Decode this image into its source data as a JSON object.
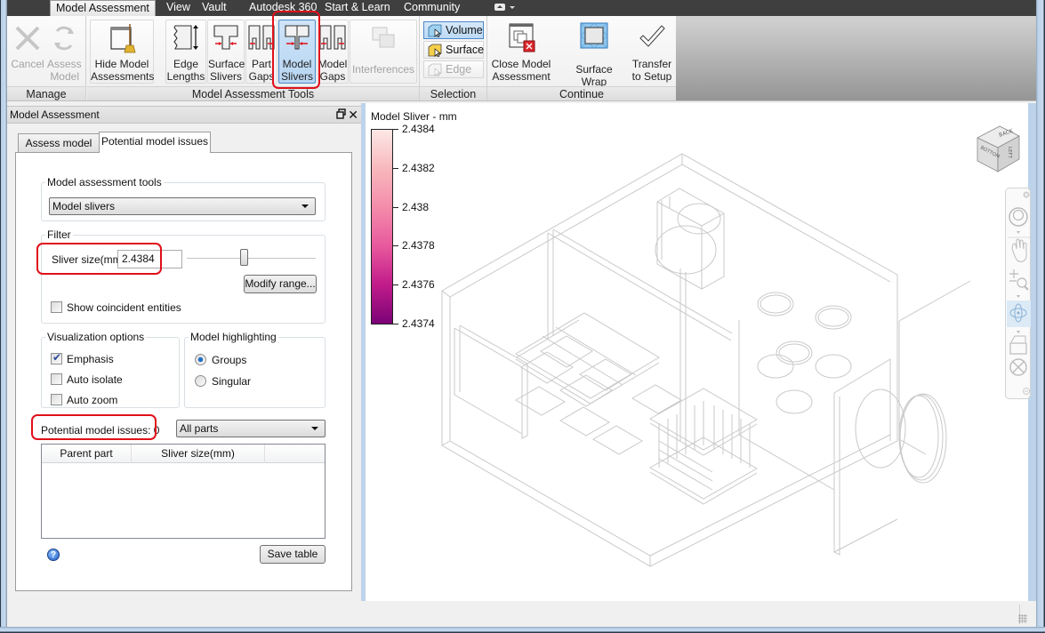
{
  "ribbon_tabs": [
    {
      "label": "Model Assessment",
      "active": true
    },
    {
      "label": "View",
      "active": false
    },
    {
      "label": "Vault",
      "active": false
    },
    {
      "label": "Autodesk 360",
      "active": false
    },
    {
      "label": "Start & Learn",
      "active": false
    },
    {
      "label": "Community",
      "active": false
    }
  ],
  "ribbon": {
    "groups": {
      "manage": "Manage",
      "tools": "Model Assessment Tools",
      "selection": "Selection",
      "continue": "Continue"
    },
    "buttons": {
      "cancel": "Cancel",
      "assess_model": "Assess Model",
      "hide_model_assessments": "Hide Model Assessments",
      "edge_lengths": "Edge Lengths",
      "surface_slivers": "Surface Slivers",
      "part_gaps": "Part Gaps",
      "model_slivers": "Model Slivers",
      "model_gaps": "Model Gaps",
      "interferences": "Interferences",
      "volume": "Volume",
      "surface": "Surface",
      "edge": "Edge",
      "close_model_assessment": "Close Model Assessment",
      "surface_wrap": "Surface Wrap",
      "transfer_to_setup": "Transfer to Setup"
    }
  },
  "panel": {
    "title": "Model Assessment",
    "tabs": [
      {
        "label": "Assess model",
        "active": false
      },
      {
        "label": "Potential model issues",
        "active": true
      }
    ],
    "tools_group": {
      "legend": "Model assessment tools",
      "selected": "Model slivers"
    },
    "filter": {
      "legend": "Filter",
      "sliver_label": "Sliver size(mm)",
      "sliver_value": "2.4384",
      "slider_position": 0.45,
      "modify_range": "Modify range...",
      "show_coincident": {
        "label": "Show coincident entities",
        "checked": false
      }
    },
    "visualization": {
      "legend": "Visualization options",
      "options": [
        {
          "label": "Emphasis",
          "checked": true
        },
        {
          "label": "Auto isolate",
          "checked": false
        },
        {
          "label": "Auto zoom",
          "checked": false
        }
      ]
    },
    "highlighting": {
      "legend": "Model highlighting",
      "options": [
        {
          "label": "Groups",
          "checked": true
        },
        {
          "label": "Singular",
          "checked": false
        }
      ]
    },
    "issues_label": "Potential model issues: 0",
    "parts_filter": "All parts",
    "table": {
      "columns": [
        "Parent part",
        "Sliver size(mm)",
        ""
      ],
      "rows": []
    },
    "save_table": "Save table",
    "help_glyph": "?"
  },
  "viewport": {
    "legend": {
      "title": "Model Sliver - mm",
      "ticks": [
        "2.4384",
        "2.4382",
        "2.438",
        "2.4378",
        "2.4376",
        "2.4374"
      ],
      "color_top": "#fde8e6",
      "color_bottom": "#7a0376"
    },
    "viewcube_faces": {
      "top": "BACK",
      "left": "BOTTOM",
      "right": "LEFT"
    }
  },
  "colors": {
    "ribbon_tab_bar": "#3f3f3f",
    "selected_button": "#b6d5f2",
    "annotation_red": "#e0101a"
  }
}
